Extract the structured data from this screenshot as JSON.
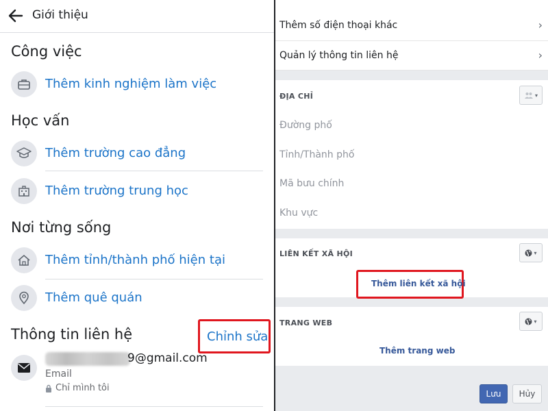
{
  "left": {
    "header": {
      "title": "Giới thiệu",
      "back_icon": "arrow-left-icon"
    },
    "work": {
      "heading": "Công việc",
      "add_work": "Thêm kinh nghiệm làm việc"
    },
    "education": {
      "heading": "Học vấn",
      "add_college": "Thêm trường cao đẳng",
      "add_highschool": "Thêm trường trung học"
    },
    "places": {
      "heading": "Nơi từng sống",
      "add_current_city": "Thêm tỉnh/thành phố hiện tại",
      "add_hometown": "Thêm quê quán"
    },
    "contact": {
      "heading": "Thông tin liên hệ",
      "edit_label": "Chỉnh sửa",
      "email_suffix": "9@gmail.com",
      "email_label": "Email",
      "privacy_label": "Chỉ mình tôi"
    }
  },
  "right": {
    "phone_row": "Thêm số điện thoại khác",
    "manage_row": "Quản lý thông tin liên hệ",
    "address": {
      "heading": "ĐỊA CHỈ",
      "street_placeholder": "Đường phố",
      "city_placeholder": "Tỉnh/Thành phố",
      "zip_placeholder": "Mã bưu chính",
      "region_placeholder": "Khu vực"
    },
    "social": {
      "heading": "LIÊN KẾT XÃ HỘI",
      "add_label": "Thêm liên kết xã hội"
    },
    "website": {
      "heading": "TRANG WEB",
      "add_label": "Thêm trang web"
    },
    "save_label": "Lưu",
    "cancel_label": "Hủy"
  },
  "colors": {
    "link": "#1a73c8",
    "highlight": "#e0161e",
    "save": "#4267b2",
    "fb_link": "#365899"
  }
}
